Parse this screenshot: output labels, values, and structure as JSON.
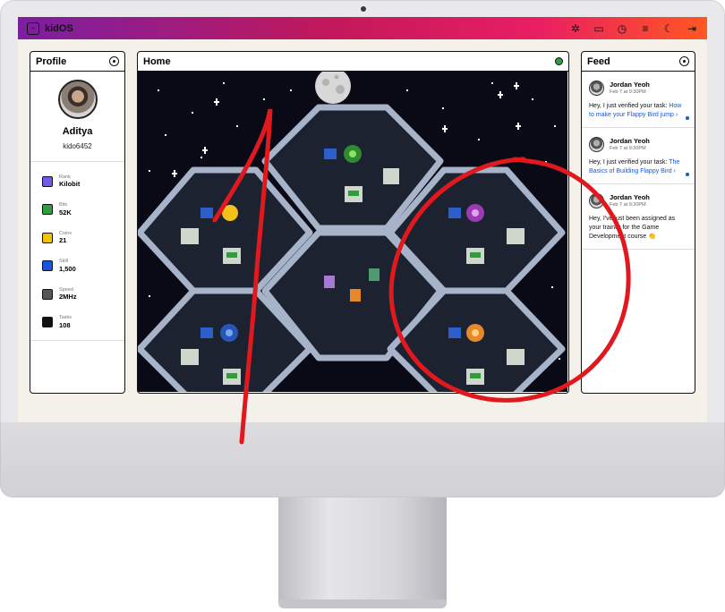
{
  "app": {
    "name": "kidOS"
  },
  "profile": {
    "title": "Profile",
    "name": "Aditya",
    "username": "kido6452",
    "stats": [
      {
        "label": "Rank",
        "value": "Kilobit",
        "icon": "rank-icon",
        "color": "#6c5ce7"
      },
      {
        "label": "Bits",
        "value": "52K",
        "icon": "bits-icon",
        "color": "#2e9e3e"
      },
      {
        "label": "Coins",
        "value": "21",
        "icon": "coin-icon",
        "color": "#f2c200"
      },
      {
        "label": "Skill",
        "value": "1,500",
        "icon": "skill-icon",
        "color": "#1a56db"
      },
      {
        "label": "Speed",
        "value": "2MHz",
        "icon": "chip-icon",
        "color": "#555555"
      },
      {
        "label": "Tasks",
        "value": "108",
        "icon": "tasks-icon",
        "color": "#111111"
      }
    ]
  },
  "home": {
    "title": "Home",
    "status_color": "#2e9e3e"
  },
  "feed": {
    "title": "Feed",
    "posts": [
      {
        "author": "Jordan Yeoh",
        "date": "Feb 7 at 9:30PM",
        "text": "Hey, I just verified your task:",
        "link": "How to make your Flappy Bird jump",
        "unread": true
      },
      {
        "author": "Jordan Yeoh",
        "date": "Feb 7 at 9:30PM",
        "text": "Hey, I just verified your task:",
        "link": "The Basics of Building Flappy Bird",
        "unread": true
      },
      {
        "author": "Jordan Yeoh",
        "date": "Feb 7 at 9:30PM",
        "text": "Hey, I've just been assigned as your trainer for the Game Development course 👏",
        "link": "",
        "unread": false
      }
    ]
  },
  "colors": {
    "accent": "#e91e63",
    "link": "#1a56db",
    "annotation": "#e0191f"
  }
}
